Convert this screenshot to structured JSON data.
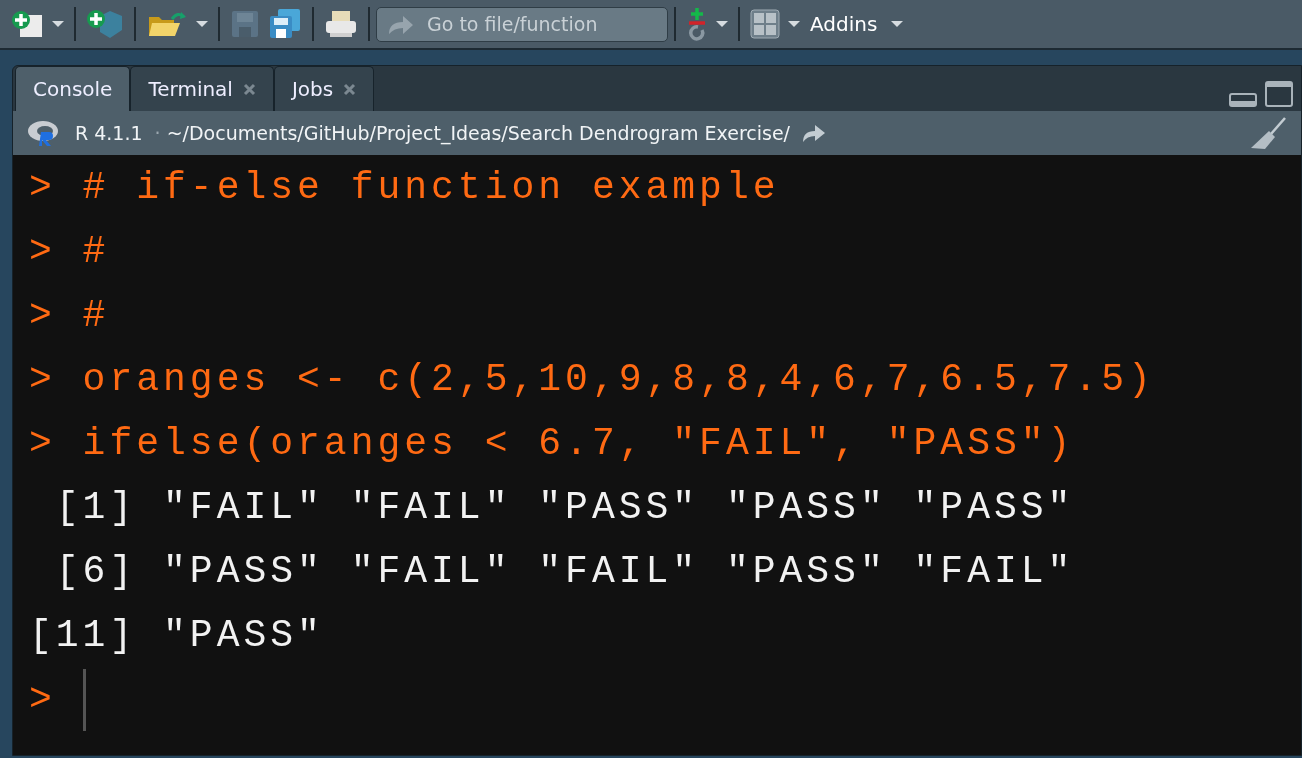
{
  "toolbar": {
    "goto_placeholder": "Go to file/function",
    "addins": "Addins"
  },
  "tabs": [
    {
      "label": "Console",
      "selected": true,
      "closable": false
    },
    {
      "label": "Terminal",
      "selected": false,
      "closable": true
    },
    {
      "label": "Jobs",
      "selected": false,
      "closable": true
    }
  ],
  "path_bar": {
    "version": "R 4.1.1",
    "separator": "·",
    "path": "~/Documents/GitHub/Project_Ideas/Search Dendrogram Exercise/"
  },
  "console": {
    "lines": [
      {
        "kind": "input",
        "prompt": ">",
        "text": "# if-else function example"
      },
      {
        "kind": "input",
        "prompt": ">",
        "text": "#"
      },
      {
        "kind": "input",
        "prompt": ">",
        "text": "#"
      },
      {
        "kind": "input",
        "prompt": ">",
        "text": "oranges <- c(2,5,10,9,8,8,4,6,7,6.5,7.5)"
      },
      {
        "kind": "input",
        "prompt": ">",
        "text": "ifelse(oranges < 6.7, \"FAIL\", \"PASS\")"
      },
      {
        "kind": "output",
        "text": " [1] \"FAIL\" \"FAIL\" \"PASS\" \"PASS\" \"PASS\""
      },
      {
        "kind": "output",
        "text": " [6] \"PASS\" \"FAIL\" \"FAIL\" \"PASS\" \"FAIL\""
      },
      {
        "kind": "output",
        "text": "[11] \"PASS\""
      },
      {
        "kind": "prompt",
        "prompt": ">"
      }
    ]
  }
}
